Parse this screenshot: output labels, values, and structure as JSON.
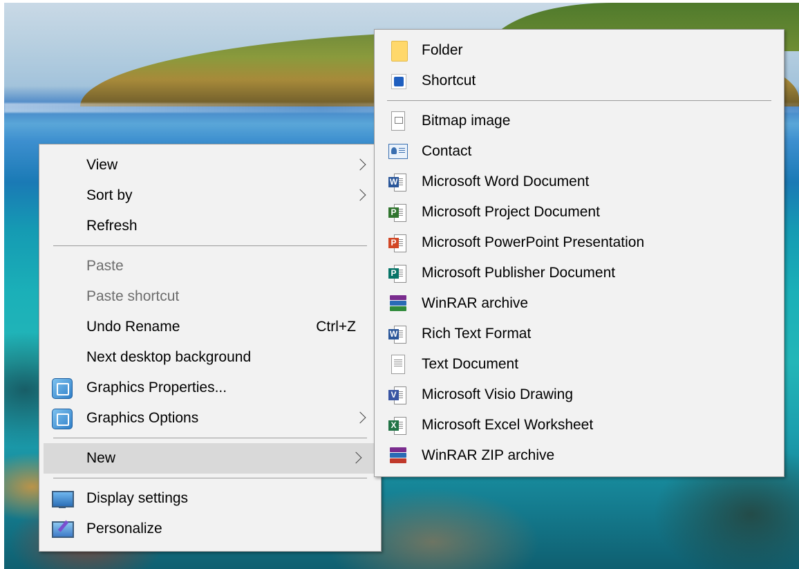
{
  "desktop": {
    "name": "Desktop"
  },
  "context_menu": {
    "items": [
      {
        "label": "View",
        "submenu": true
      },
      {
        "label": "Sort by",
        "submenu": true
      },
      {
        "label": "Refresh"
      },
      {
        "label": "Paste",
        "disabled": true
      },
      {
        "label": "Paste shortcut",
        "disabled": true
      },
      {
        "label": "Undo Rename",
        "shortcut": "Ctrl+Z"
      },
      {
        "label": "Next desktop background"
      },
      {
        "label": "Graphics Properties...",
        "icon": "graphics-icon"
      },
      {
        "label": "Graphics Options",
        "icon": "graphics-icon",
        "submenu": true
      },
      {
        "label": "New",
        "submenu": true,
        "highlighted": true
      },
      {
        "label": "Display settings",
        "icon": "display-icon"
      },
      {
        "label": "Personalize",
        "icon": "personalize-icon"
      }
    ]
  },
  "new_submenu": {
    "items": [
      {
        "label": "Folder",
        "icon": "folder-icon"
      },
      {
        "label": "Shortcut",
        "icon": "shortcut-icon"
      },
      {
        "label": "Bitmap image",
        "icon": "bitmap-icon"
      },
      {
        "label": "Contact",
        "icon": "contact-icon"
      },
      {
        "label": "Microsoft Word Document",
        "icon": "word-icon",
        "badge": "W",
        "color": "#2b579a"
      },
      {
        "label": "Microsoft Project Document",
        "icon": "project-icon",
        "badge": "P",
        "color": "#31752f"
      },
      {
        "label": "Microsoft PowerPoint Presentation",
        "icon": "powerpoint-icon",
        "badge": "P",
        "color": "#d24726"
      },
      {
        "label": "Microsoft Publisher Document",
        "icon": "publisher-icon",
        "badge": "P",
        "color": "#077568"
      },
      {
        "label": "WinRAR archive",
        "icon": "winrar-icon"
      },
      {
        "label": "Rich Text Format",
        "icon": "rtf-icon",
        "badge": "W",
        "color": "#2b579a"
      },
      {
        "label": "Text Document",
        "icon": "text-document-icon"
      },
      {
        "label": "Microsoft Visio Drawing",
        "icon": "visio-icon",
        "badge": "V",
        "color": "#3955a3"
      },
      {
        "label": "Microsoft Excel Worksheet",
        "icon": "excel-icon",
        "badge": "X",
        "color": "#217346"
      },
      {
        "label": "WinRAR ZIP archive",
        "icon": "winrar-zip-icon"
      }
    ]
  }
}
